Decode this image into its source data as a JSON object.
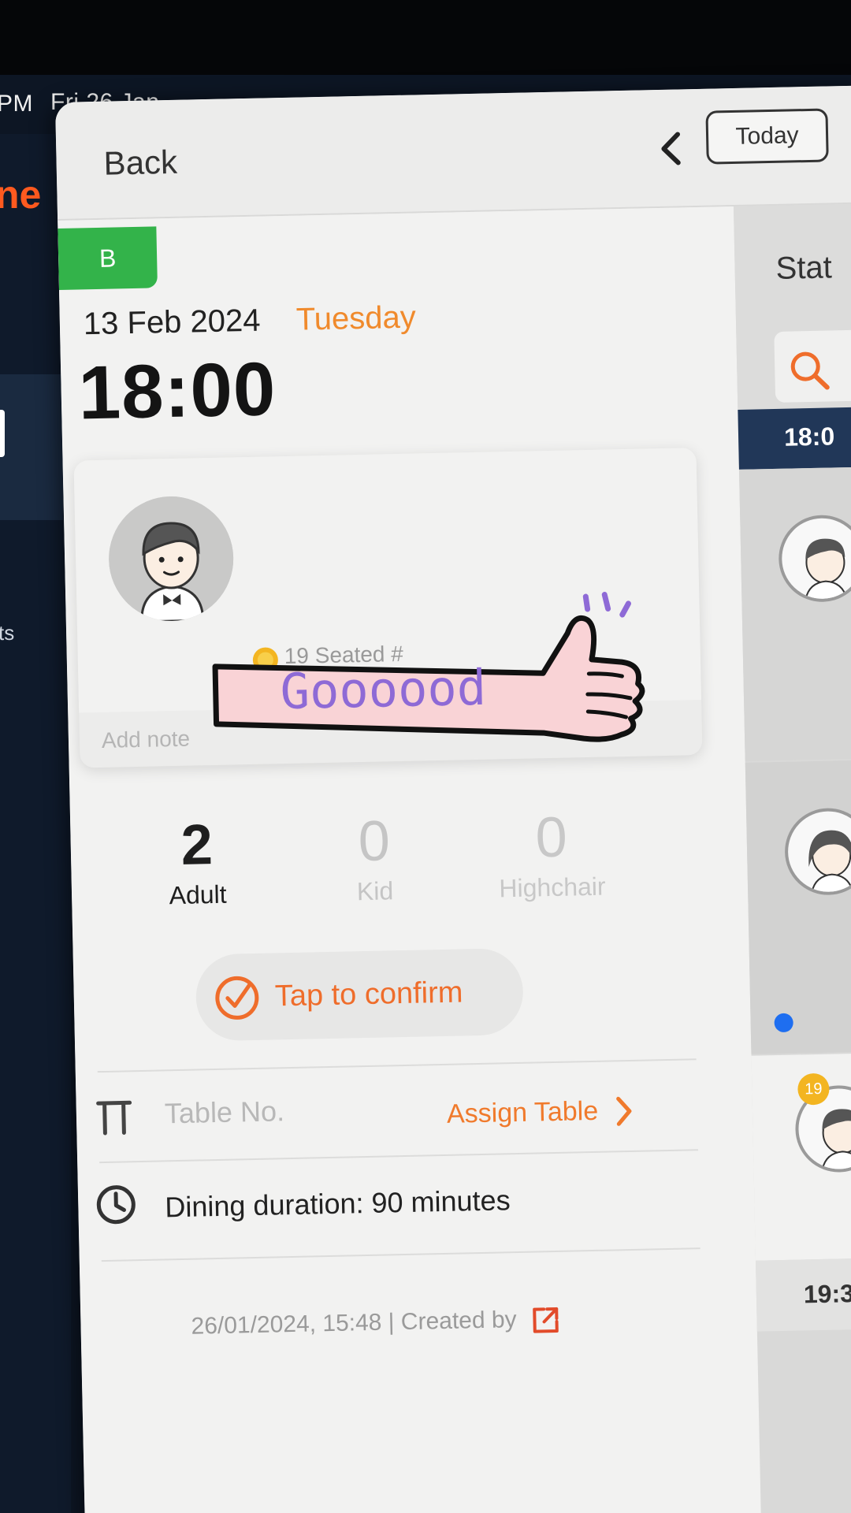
{
  "status_bar": {
    "time": "PM",
    "date": "Fri 26 Jan"
  },
  "app": {
    "logo_fragment": "ne",
    "side_label_fragment": "ts"
  },
  "header": {
    "back_label": "Back",
    "today_label": "Today"
  },
  "reservation": {
    "section_tag": "B",
    "date": "13 Feb 2024",
    "weekday": "Tuesday",
    "time": "18:00",
    "seated_info": "19 Seated #",
    "add_note_placeholder": "Add note",
    "sticker_text": "Goooood"
  },
  "party": {
    "adult_count": "2",
    "adult_label": "Adult",
    "kid_count": "0",
    "kid_label": "Kid",
    "highchair_count": "0",
    "highchair_label": "Highchair"
  },
  "actions": {
    "confirm_label": "Tap to confirm",
    "assign_table_label": "Assign Table"
  },
  "details": {
    "table_label": "Table No.",
    "duration_label": "Dining duration: 90 minutes",
    "created_text": "26/01/2024, 15:48 | Created by"
  },
  "right_column": {
    "header_fragment": "Stat",
    "time_slot_1": "18:0",
    "badge_number": "19",
    "time_slot_2": "19:3"
  },
  "colors": {
    "accent_orange": "#f07a2c",
    "section_green": "#33b34a",
    "time_bar_navy": "#213758"
  }
}
